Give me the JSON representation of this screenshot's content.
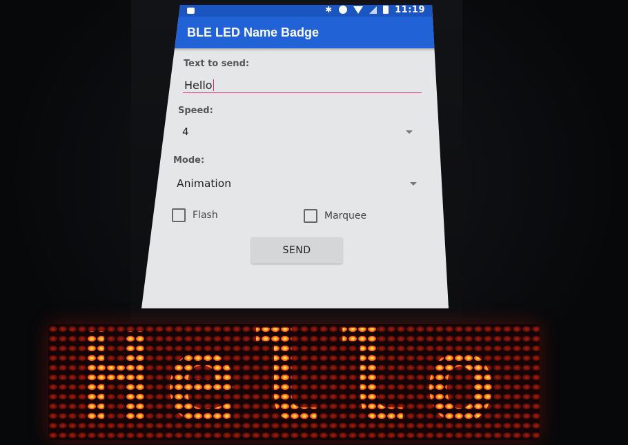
{
  "status_bar": {
    "time": "11:19",
    "icons": [
      "bluetooth-icon",
      "do-not-disturb-icon",
      "wifi-icon",
      "signal-icon",
      "battery-icon"
    ]
  },
  "app_bar": {
    "title": "BLE LED Name Badge"
  },
  "form": {
    "text_label": "Text to send:",
    "text_value": "Hello",
    "speed_label": "Speed:",
    "speed_value": "4",
    "mode_label": "Mode:",
    "mode_value": "Animation",
    "flash_label": "Flash",
    "flash_checked": false,
    "marquee_label": "Marquee",
    "marquee_checked": false,
    "send_label": "SEND"
  },
  "badge": {
    "text": "Hello",
    "color": "#ff2a12"
  }
}
